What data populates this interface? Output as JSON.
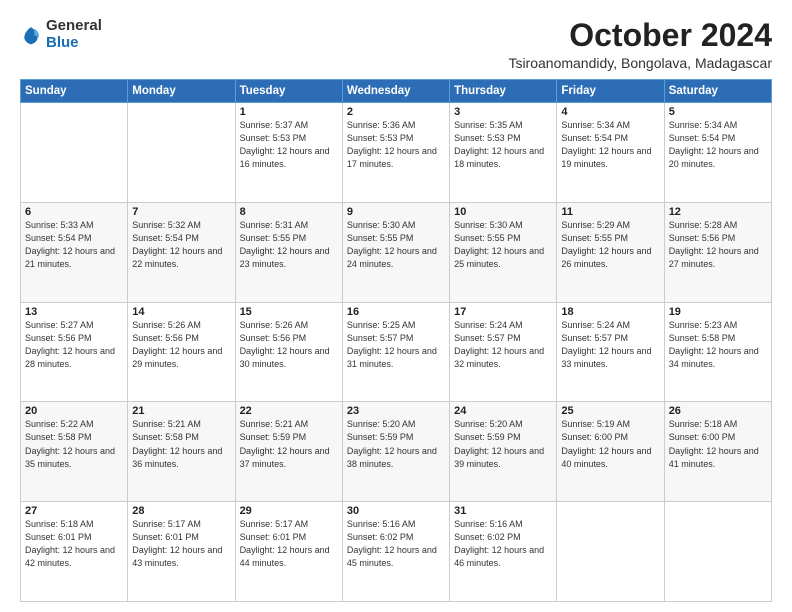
{
  "header": {
    "logo": {
      "general": "General",
      "blue": "Blue"
    },
    "title": "October 2024",
    "subtitle": "Tsiroanomandidy, Bongolava, Madagascar"
  },
  "weekdays": [
    "Sunday",
    "Monday",
    "Tuesday",
    "Wednesday",
    "Thursday",
    "Friday",
    "Saturday"
  ],
  "weeks": [
    [
      {
        "day": "",
        "sunrise": "",
        "sunset": "",
        "daylight": ""
      },
      {
        "day": "",
        "sunrise": "",
        "sunset": "",
        "daylight": ""
      },
      {
        "day": "1",
        "sunrise": "Sunrise: 5:37 AM",
        "sunset": "Sunset: 5:53 PM",
        "daylight": "Daylight: 12 hours and 16 minutes."
      },
      {
        "day": "2",
        "sunrise": "Sunrise: 5:36 AM",
        "sunset": "Sunset: 5:53 PM",
        "daylight": "Daylight: 12 hours and 17 minutes."
      },
      {
        "day": "3",
        "sunrise": "Sunrise: 5:35 AM",
        "sunset": "Sunset: 5:53 PM",
        "daylight": "Daylight: 12 hours and 18 minutes."
      },
      {
        "day": "4",
        "sunrise": "Sunrise: 5:34 AM",
        "sunset": "Sunset: 5:54 PM",
        "daylight": "Daylight: 12 hours and 19 minutes."
      },
      {
        "day": "5",
        "sunrise": "Sunrise: 5:34 AM",
        "sunset": "Sunset: 5:54 PM",
        "daylight": "Daylight: 12 hours and 20 minutes."
      }
    ],
    [
      {
        "day": "6",
        "sunrise": "Sunrise: 5:33 AM",
        "sunset": "Sunset: 5:54 PM",
        "daylight": "Daylight: 12 hours and 21 minutes."
      },
      {
        "day": "7",
        "sunrise": "Sunrise: 5:32 AM",
        "sunset": "Sunset: 5:54 PM",
        "daylight": "Daylight: 12 hours and 22 minutes."
      },
      {
        "day": "8",
        "sunrise": "Sunrise: 5:31 AM",
        "sunset": "Sunset: 5:55 PM",
        "daylight": "Daylight: 12 hours and 23 minutes."
      },
      {
        "day": "9",
        "sunrise": "Sunrise: 5:30 AM",
        "sunset": "Sunset: 5:55 PM",
        "daylight": "Daylight: 12 hours and 24 minutes."
      },
      {
        "day": "10",
        "sunrise": "Sunrise: 5:30 AM",
        "sunset": "Sunset: 5:55 PM",
        "daylight": "Daylight: 12 hours and 25 minutes."
      },
      {
        "day": "11",
        "sunrise": "Sunrise: 5:29 AM",
        "sunset": "Sunset: 5:55 PM",
        "daylight": "Daylight: 12 hours and 26 minutes."
      },
      {
        "day": "12",
        "sunrise": "Sunrise: 5:28 AM",
        "sunset": "Sunset: 5:56 PM",
        "daylight": "Daylight: 12 hours and 27 minutes."
      }
    ],
    [
      {
        "day": "13",
        "sunrise": "Sunrise: 5:27 AM",
        "sunset": "Sunset: 5:56 PM",
        "daylight": "Daylight: 12 hours and 28 minutes."
      },
      {
        "day": "14",
        "sunrise": "Sunrise: 5:26 AM",
        "sunset": "Sunset: 5:56 PM",
        "daylight": "Daylight: 12 hours and 29 minutes."
      },
      {
        "day": "15",
        "sunrise": "Sunrise: 5:26 AM",
        "sunset": "Sunset: 5:56 PM",
        "daylight": "Daylight: 12 hours and 30 minutes."
      },
      {
        "day": "16",
        "sunrise": "Sunrise: 5:25 AM",
        "sunset": "Sunset: 5:57 PM",
        "daylight": "Daylight: 12 hours and 31 minutes."
      },
      {
        "day": "17",
        "sunrise": "Sunrise: 5:24 AM",
        "sunset": "Sunset: 5:57 PM",
        "daylight": "Daylight: 12 hours and 32 minutes."
      },
      {
        "day": "18",
        "sunrise": "Sunrise: 5:24 AM",
        "sunset": "Sunset: 5:57 PM",
        "daylight": "Daylight: 12 hours and 33 minutes."
      },
      {
        "day": "19",
        "sunrise": "Sunrise: 5:23 AM",
        "sunset": "Sunset: 5:58 PM",
        "daylight": "Daylight: 12 hours and 34 minutes."
      }
    ],
    [
      {
        "day": "20",
        "sunrise": "Sunrise: 5:22 AM",
        "sunset": "Sunset: 5:58 PM",
        "daylight": "Daylight: 12 hours and 35 minutes."
      },
      {
        "day": "21",
        "sunrise": "Sunrise: 5:21 AM",
        "sunset": "Sunset: 5:58 PM",
        "daylight": "Daylight: 12 hours and 36 minutes."
      },
      {
        "day": "22",
        "sunrise": "Sunrise: 5:21 AM",
        "sunset": "Sunset: 5:59 PM",
        "daylight": "Daylight: 12 hours and 37 minutes."
      },
      {
        "day": "23",
        "sunrise": "Sunrise: 5:20 AM",
        "sunset": "Sunset: 5:59 PM",
        "daylight": "Daylight: 12 hours and 38 minutes."
      },
      {
        "day": "24",
        "sunrise": "Sunrise: 5:20 AM",
        "sunset": "Sunset: 5:59 PM",
        "daylight": "Daylight: 12 hours and 39 minutes."
      },
      {
        "day": "25",
        "sunrise": "Sunrise: 5:19 AM",
        "sunset": "Sunset: 6:00 PM",
        "daylight": "Daylight: 12 hours and 40 minutes."
      },
      {
        "day": "26",
        "sunrise": "Sunrise: 5:18 AM",
        "sunset": "Sunset: 6:00 PM",
        "daylight": "Daylight: 12 hours and 41 minutes."
      }
    ],
    [
      {
        "day": "27",
        "sunrise": "Sunrise: 5:18 AM",
        "sunset": "Sunset: 6:01 PM",
        "daylight": "Daylight: 12 hours and 42 minutes."
      },
      {
        "day": "28",
        "sunrise": "Sunrise: 5:17 AM",
        "sunset": "Sunset: 6:01 PM",
        "daylight": "Daylight: 12 hours and 43 minutes."
      },
      {
        "day": "29",
        "sunrise": "Sunrise: 5:17 AM",
        "sunset": "Sunset: 6:01 PM",
        "daylight": "Daylight: 12 hours and 44 minutes."
      },
      {
        "day": "30",
        "sunrise": "Sunrise: 5:16 AM",
        "sunset": "Sunset: 6:02 PM",
        "daylight": "Daylight: 12 hours and 45 minutes."
      },
      {
        "day": "31",
        "sunrise": "Sunrise: 5:16 AM",
        "sunset": "Sunset: 6:02 PM",
        "daylight": "Daylight: 12 hours and 46 minutes."
      },
      {
        "day": "",
        "sunrise": "",
        "sunset": "",
        "daylight": ""
      },
      {
        "day": "",
        "sunrise": "",
        "sunset": "",
        "daylight": ""
      }
    ]
  ]
}
